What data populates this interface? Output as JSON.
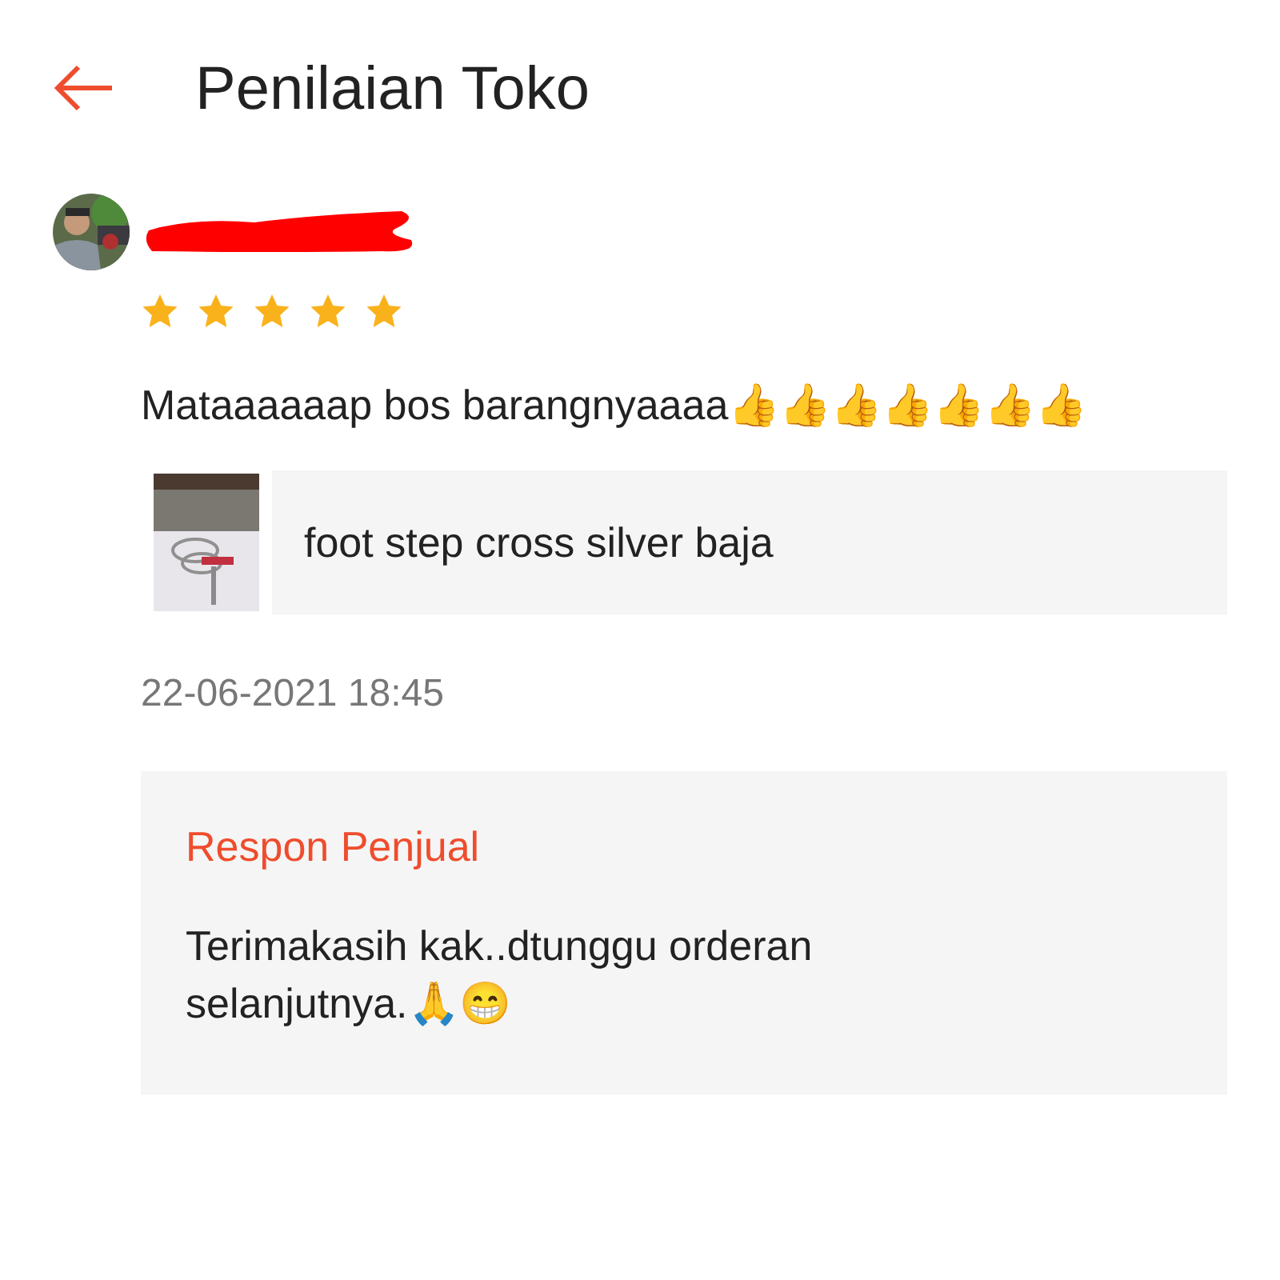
{
  "header": {
    "title": "Penilaian Toko"
  },
  "review": {
    "stars": 5,
    "comment": "Mataaaaaap bos barangnyaaaa👍👍👍👍👍👍👍",
    "product": {
      "name": "foot step cross silver baja"
    },
    "date": "22-06-2021 18:45",
    "seller_response": {
      "label": "Respon Penjual",
      "text": "Terimakasih kak..dtunggu orderan selanjutnya.🙏😁"
    }
  }
}
